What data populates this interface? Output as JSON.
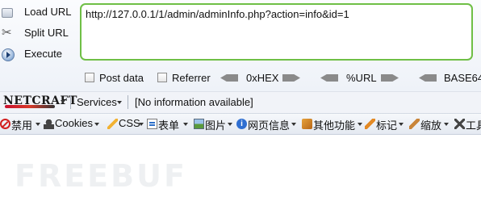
{
  "hackbar": {
    "actions": [
      {
        "label": "Load URL",
        "icon": "load-url-icon"
      },
      {
        "label": "Split URL",
        "icon": "scissors-icon"
      },
      {
        "label": "Execute",
        "icon": "execute-icon"
      }
    ],
    "url_value": "http://127.0.0.1/1/admin/adminInfo.php?action=info&id=1",
    "options": {
      "post_data": "Post data",
      "referrer": "Referrer",
      "hex": "0xHEX",
      "url": "%URL",
      "base64": "BASE64"
    }
  },
  "netcraft": {
    "logo_text": "NETCRAFT",
    "services": "Services",
    "info": "[No information available]"
  },
  "webdev": {
    "items": [
      {
        "label": "禁用",
        "icon": "disable-icon"
      },
      {
        "label": "Cookies",
        "icon": "cookie-icon"
      },
      {
        "label": "CSS",
        "icon": "css-pencil-icon"
      },
      {
        "label": "表单",
        "icon": "form-icon"
      },
      {
        "label": "图片",
        "icon": "image-icon"
      },
      {
        "label": "网页信息",
        "icon": "info-icon"
      },
      {
        "label": "其他功能",
        "icon": "misc-icon"
      },
      {
        "label": "标记",
        "icon": "outline-icon"
      },
      {
        "label": "缩放",
        "icon": "resize-icon"
      },
      {
        "label": "工具",
        "icon": "tools-icon"
      }
    ]
  },
  "watermark": "FREEBUF",
  "colors": {
    "url_border": "#6fbf46",
    "accent_red": "#c8102e"
  }
}
